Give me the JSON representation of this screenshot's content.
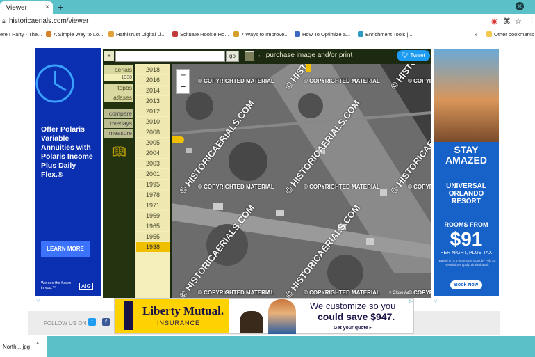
{
  "browser": {
    "tab_title": ": Viewer",
    "tab_close": "×",
    "new_tab": "+",
    "url": "historicaerials.com/viewer",
    "bookmarks": [
      {
        "label": "ere I Party - The...",
        "color": "#d33"
      },
      {
        "label": "A Simple Way to Lo...",
        "color": "#d4822a"
      },
      {
        "label": "HathiTrust Digital Li...",
        "color": "#e2a23a"
      },
      {
        "label": "Scituate Rookie Ho...",
        "color": "#c23b3b"
      },
      {
        "label": "7 Ways to Improve...",
        "color": "#d4a02a"
      },
      {
        "label": "How To Optimize a...",
        "color": "#3a6ac2"
      },
      {
        "label": "Enrichment Tools |...",
        "color": "#2a9ac2"
      }
    ],
    "bookmarks_more": "»",
    "other_bookmarks": "Other bookmarks",
    "download_file": "North....jpg",
    "download_chevron": "^"
  },
  "viewer": {
    "plus": "+",
    "go": "go",
    "purchase": "← purchase image and/or print",
    "tweet": "Tweet",
    "menu": [
      "aerials",
      "topos",
      "atlases",
      "compare",
      "overlays",
      "measure"
    ],
    "selected_sub": "1938",
    "years": [
      "2018",
      "2016",
      "2014",
      "2013",
      "2012",
      "2010",
      "2008",
      "2005",
      "2004",
      "2003",
      "2001",
      "1995",
      "1978",
      "1971",
      "1969",
      "1965",
      "1955",
      "1938"
    ],
    "selected_year": "1938",
    "zoom_in": "+",
    "zoom_out": "−",
    "watermark_copyright": "© COPYRIGHTED MATERIAL",
    "watermark_site": "© HISTORICAERIALS.COM",
    "close_ad": "× Close Ad"
  },
  "left_ad": {
    "headline": "Offer Polaris Variable Annuities with Polaris Income Plus Daily Flex.®",
    "button": "LEARN MORE",
    "tagline": "We see the future in you.™",
    "brand": "AIG"
  },
  "right_ad": {
    "headline": "STAY AMAZED",
    "brand": "UNIVERSAL ORLANDO RESORT",
    "rooms_from": "ROOMS FROM",
    "price": "$91",
    "per_night": "PER NIGHT, PLUS TAX",
    "fine_print": "*Based on a 4-night stay. Book by Feb 15. Restrictions apply. Limited avail.",
    "cta": "Book Now"
  },
  "bottom_ad": {
    "brand": "Liberty Mutual.",
    "subbrand": "INSURANCE",
    "line1": "We customize so you",
    "line2": "could save $947.",
    "cta": "Get your quote ▸"
  },
  "footer": {
    "follow_us": "FOLLOW US ON",
    "twitter": "t",
    "facebook": "f"
  }
}
